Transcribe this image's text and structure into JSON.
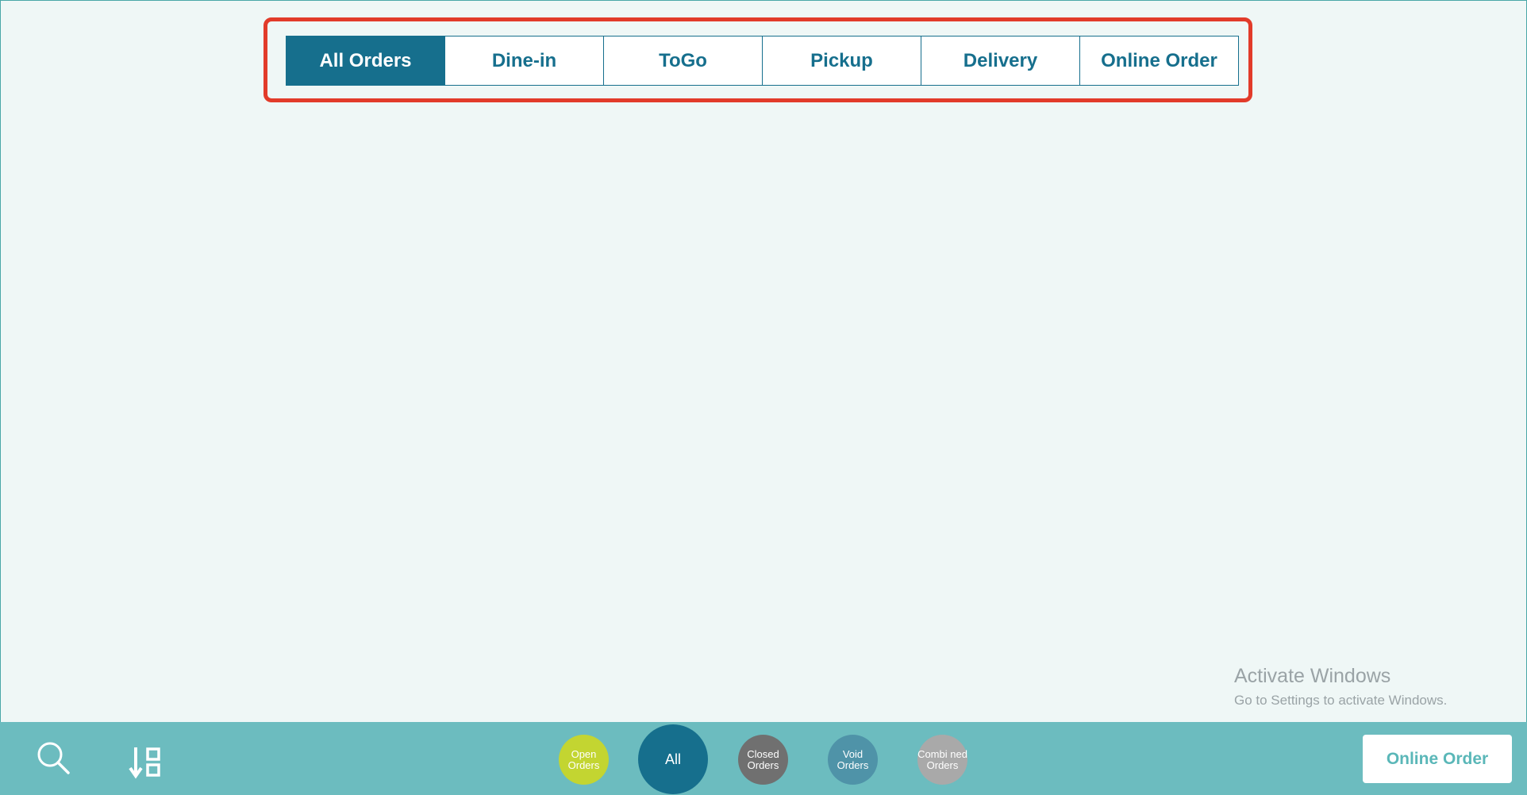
{
  "tabs": [
    {
      "label": "All Orders",
      "active": true
    },
    {
      "label": "Dine-in"
    },
    {
      "label": "ToGo"
    },
    {
      "label": "Pickup"
    },
    {
      "label": "Delivery"
    },
    {
      "label": "Online Order"
    }
  ],
  "status_filters": {
    "open": "Open Orders",
    "all": "All",
    "closed": "Closed Orders",
    "void": "Void Orders",
    "combined": "Combi ned Orders"
  },
  "bottom_bar": {
    "online_order_label": "Online Order",
    "icons": [
      "search-icon",
      "sort-icon"
    ]
  },
  "watermark": {
    "title": "Activate Windows",
    "subtitle": "Go to Settings to activate Windows."
  },
  "colors": {
    "primary": "#166f8d",
    "bar": "#6cbcbf",
    "open": "#c3d531",
    "closed": "#707070",
    "void": "#4f93a8",
    "combined": "#a9a9a9",
    "highlight": "#e23b2a",
    "background": "#eff7f6"
  }
}
